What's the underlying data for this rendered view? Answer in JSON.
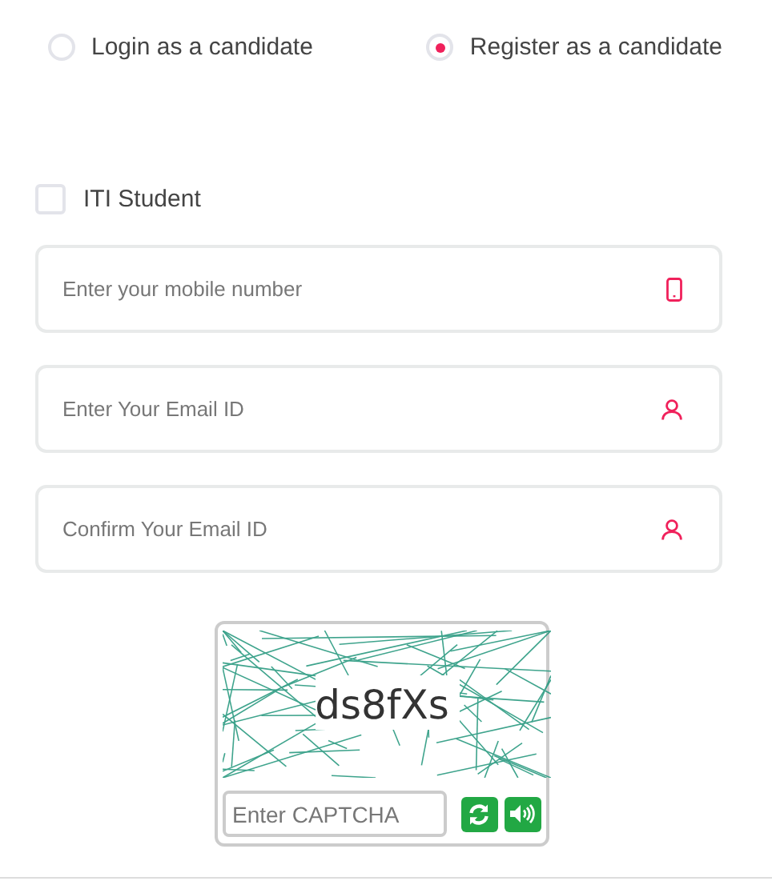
{
  "login_mode": [
    {
      "label": "Login as a candidate",
      "selected": false
    },
    {
      "label": "Register as a candidate",
      "selected": true
    }
  ],
  "iti_student": {
    "label": "ITI Student",
    "checked": false
  },
  "fields": [
    {
      "kind": "phone",
      "placeholder": "Enter your mobile number"
    },
    {
      "kind": "email",
      "placeholder": "Enter Your Email ID"
    },
    {
      "kind": "email",
      "placeholder": "Confirm Your Email ID"
    }
  ],
  "captcha": {
    "code": "ds8fXs",
    "input": {
      "placeholder": "Enter CAPTCHA"
    }
  }
}
